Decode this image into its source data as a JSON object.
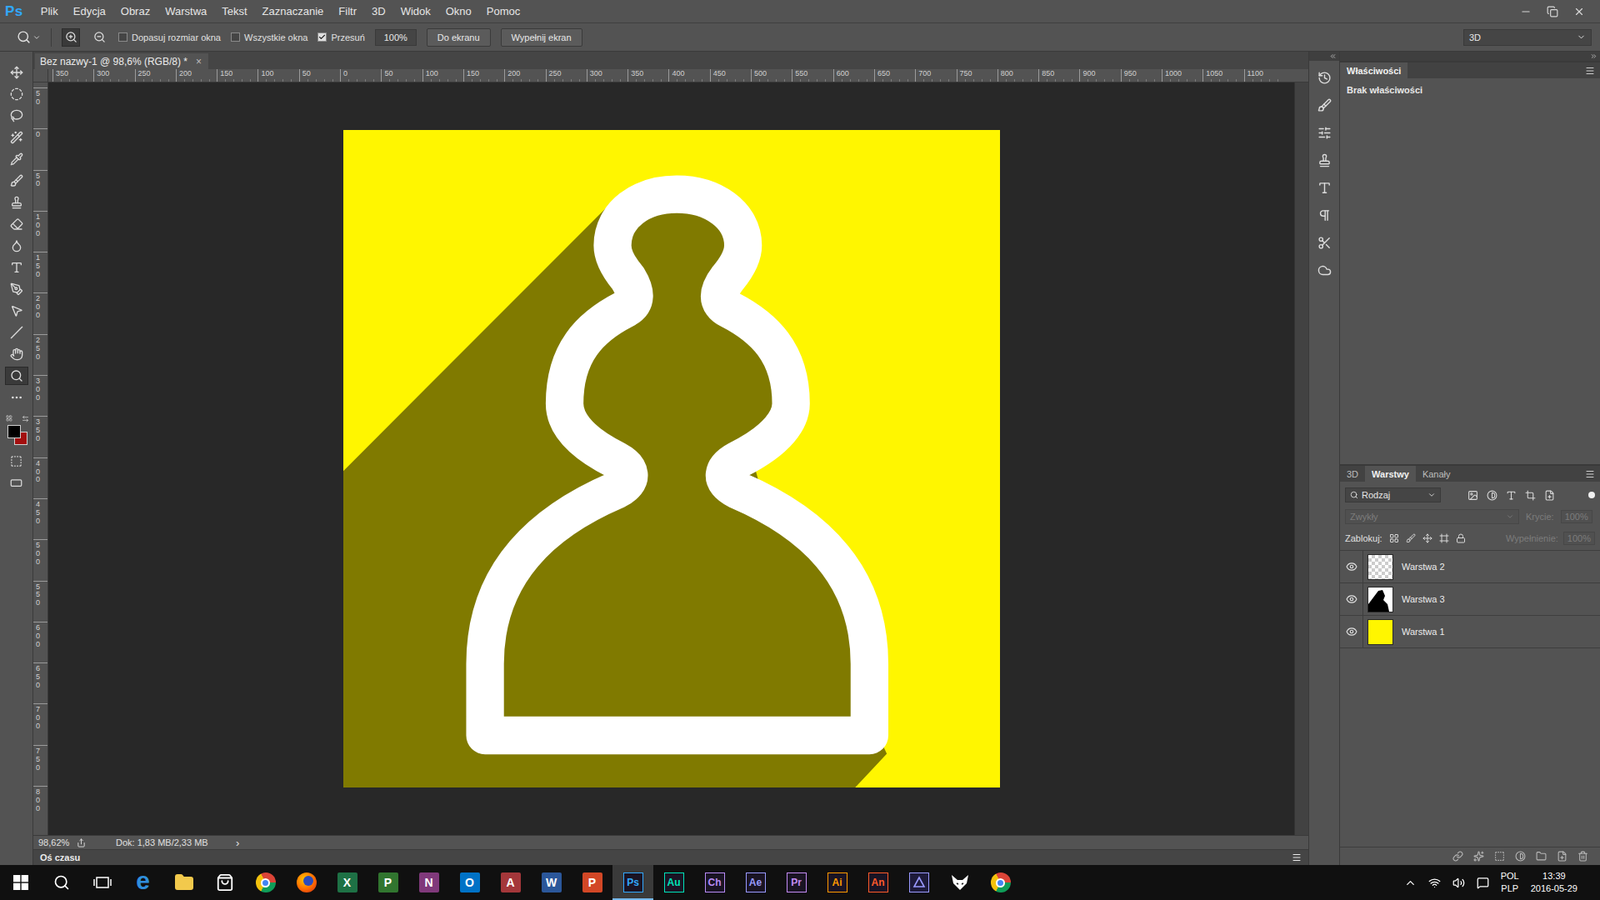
{
  "app": {
    "logo": "Ps"
  },
  "window_controls": [
    {
      "kind": "minimize"
    },
    {
      "kind": "restore"
    },
    {
      "kind": "close"
    }
  ],
  "menu": [
    "Plik",
    "Edycja",
    "Obraz",
    "Warstwa",
    "Tekst",
    "Zaznaczanie",
    "Filtr",
    "3D",
    "Widok",
    "Okno",
    "Pomoc"
  ],
  "options_bar": {
    "checkboxes": [
      {
        "label": "Dopasuj rozmiar okna",
        "checked": false
      },
      {
        "label": "Wszystkie okna",
        "checked": false
      },
      {
        "label": "Przesuń",
        "checked": true
      }
    ],
    "zoom_field": "100%",
    "buttons": [
      "Do ekranu",
      "Wypełnij ekran"
    ],
    "workspace": "3D"
  },
  "toolbar": {
    "tools": [
      {
        "kind": "move",
        "selected": false
      },
      {
        "kind": "marquee",
        "selected": false
      },
      {
        "kind": "lasso",
        "selected": false
      },
      {
        "kind": "wand",
        "selected": false
      },
      {
        "kind": "eyedropper",
        "selected": false
      },
      {
        "kind": "brush",
        "selected": false
      },
      {
        "kind": "stamp",
        "selected": false
      },
      {
        "kind": "eraser",
        "selected": false
      },
      {
        "kind": "blur",
        "selected": false
      },
      {
        "kind": "type",
        "selected": false
      },
      {
        "kind": "pen",
        "selected": false
      },
      {
        "kind": "path-select",
        "selected": false
      },
      {
        "kind": "line",
        "selected": false
      },
      {
        "kind": "hand",
        "selected": false
      },
      {
        "kind": "zoom",
        "selected": true
      },
      {
        "kind": "more",
        "selected": false
      }
    ],
    "colors": {
      "foreground": "#000000",
      "background": "#a30f0f"
    }
  },
  "document": {
    "tab_title": "Bez nazwy-1 @ 98,6% (RGB/8) *",
    "close": "×"
  },
  "rulers": {
    "horizontal": [
      "350",
      "300",
      "250",
      "200",
      "150",
      "100",
      "50",
      "0",
      "50",
      "100",
      "150",
      "200",
      "250",
      "300",
      "350",
      "400",
      "450",
      "500",
      "550",
      "600",
      "650",
      "700",
      "750",
      "800",
      "850",
      "900",
      "950",
      "1000",
      "1050",
      "1100"
    ],
    "vertical": [
      "50",
      "0",
      "50",
      "100",
      "150",
      "200",
      "250",
      "300",
      "350",
      "400",
      "450",
      "500",
      "550",
      "600",
      "650",
      "700",
      "750",
      "800"
    ]
  },
  "status_bar": {
    "zoom": "98,62%",
    "doc": "Dok: 1,83 MB/2,33 MB",
    "arrow": "›"
  },
  "timeline": {
    "label": "Oś czasu"
  },
  "properties_panel": {
    "tab": "Właściwości",
    "message": "Brak właściwości"
  },
  "layers_panel": {
    "tabs": [
      {
        "label": "3D",
        "selected": false
      },
      {
        "label": "Warstwy",
        "selected": true
      },
      {
        "label": "Kanały",
        "selected": false
      }
    ],
    "filter": "Rodzaj",
    "filter_toggle": {
      "on": true
    },
    "blend_mode": {
      "value": "Zwykły",
      "disabled": true
    },
    "opacity": {
      "label": "Krycie:",
      "value": "100%",
      "disabled": true
    },
    "lock_label": "Zablokuj:",
    "fill": {
      "label": "Wypełnienie:",
      "value": "100%",
      "disabled": true
    },
    "layers": [
      {
        "name": "Warstwa 2",
        "visible": true,
        "selected": false,
        "kind": "transparent"
      },
      {
        "name": "Warstwa 3",
        "visible": true,
        "selected": false,
        "kind": "shape"
      },
      {
        "name": "Warstwa 1",
        "visible": true,
        "selected": false,
        "kind": "fill"
      }
    ]
  },
  "taskbar": {
    "apps": [
      {
        "kind": "start",
        "selected": false
      },
      {
        "kind": "search",
        "selected": false
      },
      {
        "kind": "taskview",
        "selected": false
      },
      {
        "kind": "edge",
        "label": "e",
        "selected": false,
        "color": "#2f8fdc"
      },
      {
        "kind": "folder",
        "selected": false
      },
      {
        "kind": "store",
        "selected": false
      },
      {
        "kind": "chrome",
        "selected": false
      },
      {
        "kind": "firefox",
        "selected": false
      },
      {
        "kind": "office",
        "label": "X",
        "selected": false,
        "color": "#1e7145"
      },
      {
        "kind": "office",
        "label": "P",
        "selected": false,
        "color": "#31752f"
      },
      {
        "kind": "office",
        "label": "N",
        "selected": false,
        "color": "#80397b"
      },
      {
        "kind": "office",
        "label": "O",
        "selected": false,
        "color": "#0072c6"
      },
      {
        "kind": "office",
        "label": "A",
        "selected": false,
        "color": "#a4373a"
      },
      {
        "kind": "office",
        "label": "W",
        "selected": false,
        "color": "#2b579a"
      },
      {
        "kind": "office",
        "label": "P",
        "selected": false,
        "color": "#d24726"
      },
      {
        "kind": "adobe",
        "label": "Ps",
        "selected": true,
        "color": "#31a8ff"
      },
      {
        "kind": "adobe",
        "label": "Au",
        "selected": false,
        "color": "#00e4bb"
      },
      {
        "kind": "adobe",
        "label": "Ch",
        "selected": false,
        "color": "#b88bf7"
      },
      {
        "kind": "adobe",
        "label": "Ae",
        "selected": false,
        "color": "#9999ff"
      },
      {
        "kind": "adobe",
        "label": "Pr",
        "selected": false,
        "color": "#c38bf5"
      },
      {
        "kind": "adobe",
        "label": "Ai",
        "selected": false,
        "color": "#ff9a00"
      },
      {
        "kind": "adobe",
        "label": "An",
        "selected": false,
        "color": "#ff5a2b"
      },
      {
        "kind": "encoder",
        "selected": false
      },
      {
        "kind": "fox",
        "selected": false
      },
      {
        "kind": "chrome",
        "selected": false
      }
    ],
    "tray": {
      "language": "POL",
      "layout": "PLP",
      "time": "13:39",
      "date": "2016-05-29"
    }
  }
}
